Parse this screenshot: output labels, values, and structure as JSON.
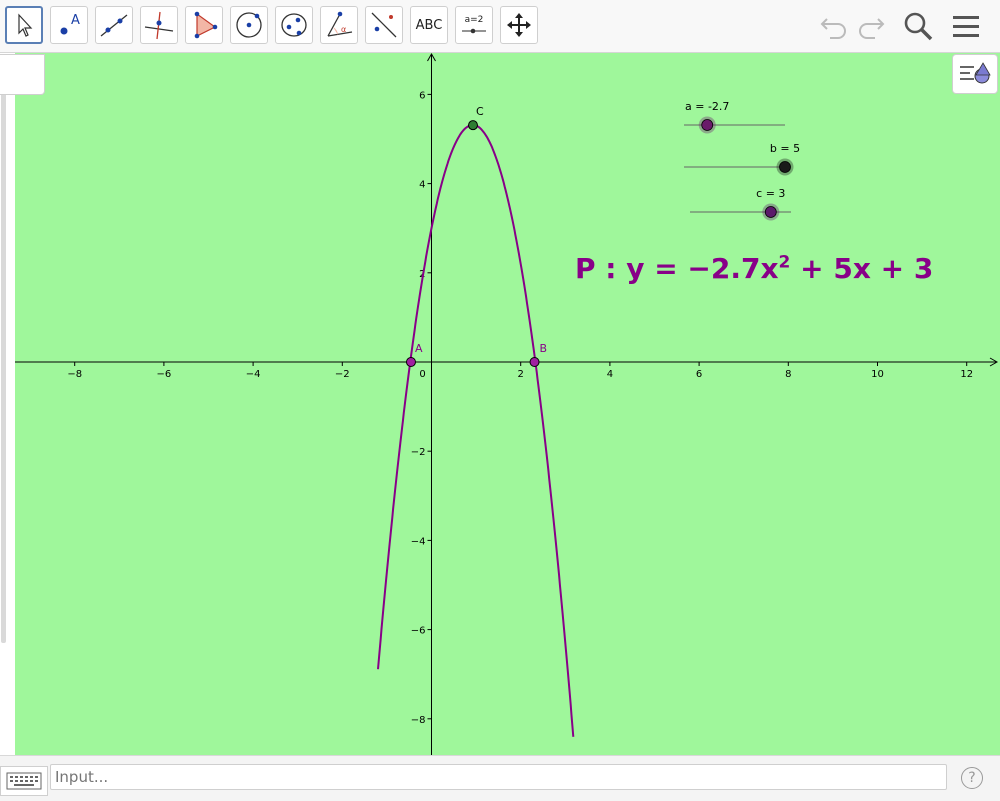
{
  "toolbar": {
    "tools": [
      {
        "id": "move",
        "label": ""
      },
      {
        "id": "point",
        "label": "A"
      },
      {
        "id": "line",
        "label": ""
      },
      {
        "id": "perpendicular-line",
        "label": ""
      },
      {
        "id": "polygon",
        "label": ""
      },
      {
        "id": "circle-center-point",
        "label": ""
      },
      {
        "id": "ellipse",
        "label": ""
      },
      {
        "id": "angle",
        "label": ""
      },
      {
        "id": "reflect",
        "label": ""
      },
      {
        "id": "text",
        "label": "ABC"
      },
      {
        "id": "slider",
        "label": "a=2"
      },
      {
        "id": "move-graphics-view",
        "label": ""
      }
    ],
    "right_icons": [
      "undo-icon",
      "redo-icon",
      "search-icon",
      "menu-icon"
    ]
  },
  "graphics": {
    "background_color": "#9ff79b",
    "curve_color": "#880088",
    "x_ticks": [
      "−8",
      "−6",
      "−4",
      "−2",
      "0",
      "2",
      "4",
      "6",
      "8",
      "10",
      "12"
    ],
    "y_ticks": [
      "6",
      "4",
      "2",
      "−2",
      "−4",
      "−6",
      "−8"
    ],
    "points": {
      "A": {
        "label": "A",
        "x": -0.46
      },
      "B": {
        "label": "B",
        "x": 2.31
      },
      "C": {
        "label": "C",
        "x": 0.93,
        "y": 5.31
      }
    },
    "sliders": [
      {
        "name": "a",
        "label": "a = -2.7",
        "value": -2.7,
        "min": -5,
        "max": 5
      },
      {
        "name": "b",
        "label": "b = 5",
        "value": 5,
        "min": -5,
        "max": 5
      },
      {
        "name": "c",
        "label": "c = 3",
        "value": 3,
        "min": -5,
        "max": 5
      }
    ],
    "formula": {
      "lhs": "P : y = −2.7x",
      "exponent": "2",
      "rhs": " + 5x + 3"
    }
  },
  "input_bar": {
    "placeholder": "Input..."
  },
  "help_label": "?"
}
